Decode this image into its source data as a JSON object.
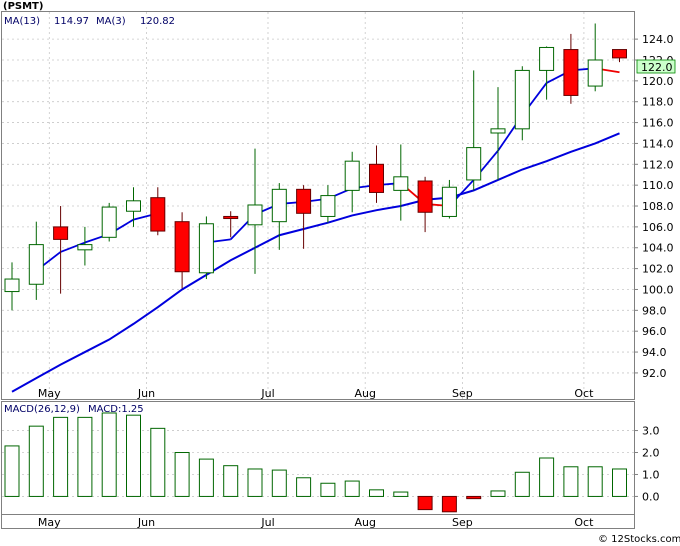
{
  "chart_data": [
    {
      "type": "candlestick",
      "title": "(PSMT)",
      "indicators": [
        {
          "label": "MA(13)",
          "value": "114.97"
        },
        {
          "label": "MA(3)",
          "value": "120.82"
        }
      ],
      "last_price_label": "122.0",
      "ylim": [
        89.5,
        126.6
      ],
      "yticks": [
        92,
        94,
        96,
        98,
        100,
        102,
        104,
        106,
        108,
        110,
        112,
        114,
        116,
        118,
        120,
        122,
        124
      ],
      "ytick_labels": [
        "92.0",
        "94.0",
        "96.0",
        "98.0",
        "100.0",
        "102.0",
        "104.0",
        "106.0",
        "108.0",
        "110.0",
        "112.0",
        "114.0",
        "116.0",
        "118.0",
        "120.0",
        "122.0",
        "124.0"
      ],
      "months": [
        {
          "label": "May",
          "week": 1
        },
        {
          "label": "Jun",
          "week": 5
        },
        {
          "label": "Jul",
          "week": 10
        },
        {
          "label": "Aug",
          "week": 14
        },
        {
          "label": "Sep",
          "week": 18
        },
        {
          "label": "Oct",
          "week": 23
        }
      ],
      "candles": [
        {
          "o": 99.8,
          "h": 102.6,
          "l": 98.0,
          "c": 101.0
        },
        {
          "o": 100.5,
          "h": 106.5,
          "l": 99.0,
          "c": 104.3
        },
        {
          "o": 106.0,
          "h": 108.0,
          "l": 99.6,
          "c": 104.8
        },
        {
          "o": 103.8,
          "h": 106.0,
          "l": 102.3,
          "c": 104.3
        },
        {
          "o": 105.0,
          "h": 108.3,
          "l": 104.6,
          "c": 107.9
        },
        {
          "o": 107.5,
          "h": 109.8,
          "l": 106.0,
          "c": 108.5
        },
        {
          "o": 108.8,
          "h": 109.8,
          "l": 105.2,
          "c": 105.6
        },
        {
          "o": 106.5,
          "h": 107.4,
          "l": 100.1,
          "c": 101.7
        },
        {
          "o": 101.6,
          "h": 107.0,
          "l": 101.0,
          "c": 106.3
        },
        {
          "o": 107.0,
          "h": 107.5,
          "l": 105.0,
          "c": 106.8
        },
        {
          "o": 106.2,
          "h": 113.5,
          "l": 101.5,
          "c": 108.1
        },
        {
          "o": 106.5,
          "h": 110.2,
          "l": 103.8,
          "c": 109.6
        },
        {
          "o": 109.6,
          "h": 110.0,
          "l": 103.9,
          "c": 107.3
        },
        {
          "o": 107.0,
          "h": 110.0,
          "l": 106.4,
          "c": 109.0
        },
        {
          "o": 109.5,
          "h": 113.2,
          "l": 107.4,
          "c": 112.3
        },
        {
          "o": 112.0,
          "h": 113.8,
          "l": 108.3,
          "c": 109.3
        },
        {
          "o": 109.5,
          "h": 113.9,
          "l": 106.6,
          "c": 110.8
        },
        {
          "o": 110.4,
          "h": 110.8,
          "l": 105.5,
          "c": 107.4
        },
        {
          "o": 107.0,
          "h": 110.5,
          "l": 106.8,
          "c": 109.8
        },
        {
          "o": 110.5,
          "h": 121.0,
          "l": 109.5,
          "c": 113.6
        },
        {
          "o": 115.0,
          "h": 119.4,
          "l": 110.5,
          "c": 115.4
        },
        {
          "o": 115.4,
          "h": 121.4,
          "l": 114.3,
          "c": 121.0
        },
        {
          "o": 121.0,
          "h": 123.3,
          "l": 118.2,
          "c": 123.2
        },
        {
          "o": 123.0,
          "h": 124.5,
          "l": 117.8,
          "c": 118.6
        },
        {
          "o": 119.5,
          "h": 125.5,
          "l": 119.0,
          "c": 122.0
        },
        {
          "o": 123.0,
          "h": 123.0,
          "l": 121.8,
          "c": 122.2
        }
      ],
      "ma13": [
        90.2,
        91.5,
        92.8,
        94.0,
        95.2,
        96.7,
        98.3,
        100.0,
        101.4,
        102.8,
        104.0,
        105.2,
        105.8,
        106.4,
        107.1,
        107.6,
        108.0,
        108.6,
        108.8,
        109.5,
        110.5,
        111.5,
        112.3,
        113.2,
        114.0,
        114.97
      ],
      "ma3_black_until": 5,
      "ma3": [
        null,
        101.8,
        103.6,
        104.5,
        105.3,
        106.7,
        107.3,
        null,
        104.5,
        104.8,
        107.2,
        108.2,
        108.4,
        108.7,
        109.7,
        110.0,
        110.2,
        108.2,
        108.0,
        110.5,
        113.3,
        116.7,
        119.8,
        121.0,
        121.2,
        120.82
      ],
      "ma_colors": {
        "ma13": "#0000dd",
        "ma3": "#0000dd",
        "ma3_down": "#ee0000"
      },
      "candle_colors": {
        "up_fill": "#ffffff",
        "up_stroke": "#006600",
        "down_fill": "#ff0000",
        "down_stroke": "#660000"
      }
    },
    {
      "type": "bar",
      "label": "MACD(26,12,9)",
      "macd_value_label": "MACD:1.25",
      "ylim": [
        -0.8,
        4.3
      ],
      "yticks": [
        0.0,
        1.0,
        2.0,
        3.0
      ],
      "ytick_labels": [
        "0.0",
        "1.0",
        "2.0",
        "3.0"
      ],
      "values": [
        2.3,
        3.2,
        3.6,
        3.6,
        3.8,
        3.7,
        3.1,
        2.0,
        1.7,
        1.4,
        1.25,
        1.2,
        0.85,
        0.6,
        0.7,
        0.3,
        0.2,
        -0.6,
        -0.7,
        -0.1,
        0.25,
        1.1,
        1.75,
        1.35,
        1.35,
        1.25
      ],
      "pos_color": "#006600",
      "neg_color": "#ff0000"
    }
  ],
  "watermark": "© 12Stocks.com"
}
